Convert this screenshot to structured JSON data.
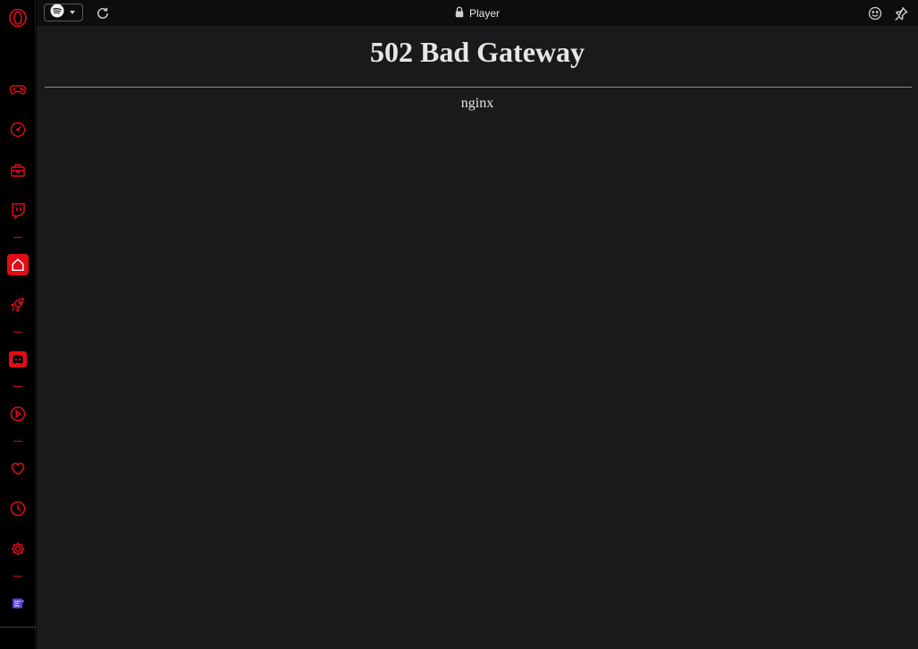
{
  "sidebar": {
    "accent": "#e00d16",
    "items": [
      {
        "name": "opera-logo-icon"
      },
      {
        "name": "gamepad-icon"
      },
      {
        "name": "speedometer-icon"
      },
      {
        "name": "briefcase-icon"
      },
      {
        "name": "twitch-icon"
      },
      {
        "name": "home-icon",
        "active": true
      },
      {
        "name": "rocket-icon"
      },
      {
        "name": "discord-icon"
      },
      {
        "name": "play-circle-icon"
      },
      {
        "name": "heart-icon"
      },
      {
        "name": "clock-icon"
      },
      {
        "name": "gear-icon"
      },
      {
        "name": "extension-icon"
      }
    ]
  },
  "panel_header": {
    "service_icon": "spotify-icon",
    "title": "Player",
    "lock_icon": "lock-icon",
    "reload_icon": "reload-icon",
    "emoji_icon": "emoji-icon",
    "pin_icon": "pin-icon"
  },
  "content": {
    "heading": "502 Bad Gateway",
    "server": "nginx",
    "background": "#181a1b",
    "text_color": "#e8e6e3"
  }
}
